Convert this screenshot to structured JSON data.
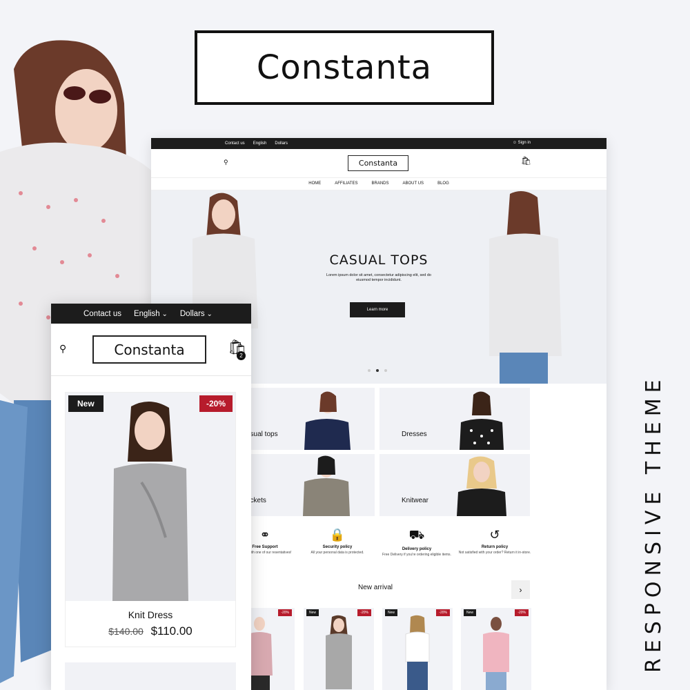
{
  "brand": {
    "name": "Constanta"
  },
  "side_label": "RESPONSIVE THEME",
  "desktop": {
    "topbar": {
      "contact": "Contact us",
      "language": "English",
      "currency": "Dollars",
      "signin": "Sign in"
    },
    "logo": "Constanta",
    "nav": [
      "HOME",
      "AFFILIATES",
      "BRANDS",
      "ABOUT US",
      "BLOG"
    ],
    "hero": {
      "title": "CASUAL TOPS",
      "text": "Lorem ipsum dolor sit amet, consectetur adipiscing elit, sed do eiusmod tempor incididunt.",
      "button": "Learn more",
      "slides": 3,
      "active_slide": 2
    },
    "categories": [
      "asual tops",
      "Dresses",
      "ackets",
      "Knitwear"
    ],
    "features": [
      {
        "icon": "headset-icon",
        "title": "Free Support",
        "text": "alking with one of our resentatives!"
      },
      {
        "icon": "lock-icon",
        "title": "Security policy",
        "text": "All your personal data is protected."
      },
      {
        "icon": "truck-icon",
        "title": "Delivery policy",
        "text": "Free Delivery if you're ordering eligible items."
      },
      {
        "icon": "return-icon",
        "title": "Return policy",
        "text": "Not satisfied with your order? Return it in-store."
      }
    ],
    "section_title": "New arrival",
    "products": [
      {
        "new": "",
        "discount": "-20%"
      },
      {
        "new": "New",
        "discount": "-20%"
      },
      {
        "new": "New",
        "discount": "-20%"
      },
      {
        "new": "New",
        "discount": "-20%"
      }
    ]
  },
  "mobile": {
    "topbar": {
      "contact": "Contact us",
      "language": "English",
      "currency": "Dollars"
    },
    "logo": "Constanta",
    "cart_count": "2",
    "product": {
      "badge_new": "New",
      "badge_discount": "-20%",
      "name": "Knit Dress",
      "old_price": "$140.00",
      "price": "$110.00"
    }
  },
  "colors": {
    "dark": "#1c1c1c",
    "sale": "#b71c2c",
    "bg": "#f3f4f8"
  }
}
